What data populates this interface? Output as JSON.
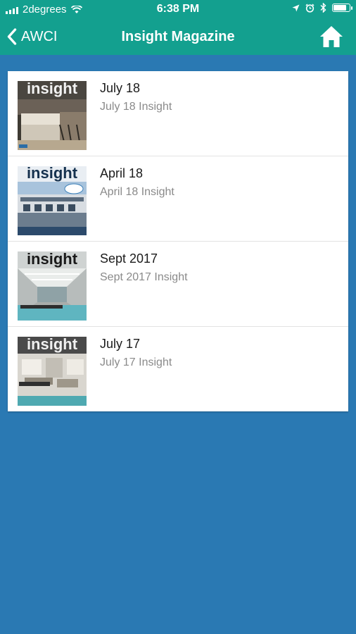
{
  "status": {
    "carrier": "2degrees",
    "time": "6:38 PM"
  },
  "nav": {
    "back_label": "AWCI",
    "title": "Insight Magazine"
  },
  "issues": [
    {
      "title": "July 18",
      "subtitle": "July 18 Insight",
      "cover_word": "insight"
    },
    {
      "title": "April 18",
      "subtitle": "April 18 Insight",
      "cover_word": "insight"
    },
    {
      "title": "Sept 2017",
      "subtitle": "Sept 2017 Insight",
      "cover_word": "insight"
    },
    {
      "title": "July 17",
      "subtitle": "July 17 Insight",
      "cover_word": "insight"
    }
  ],
  "colors": {
    "header": "#13a08f",
    "background": "#2a79b3"
  },
  "icons": [
    "signal-icon",
    "wifi-icon",
    "location-icon",
    "alarm-icon",
    "bluetooth-icon",
    "battery-icon",
    "chevron-left-icon",
    "home-icon"
  ]
}
